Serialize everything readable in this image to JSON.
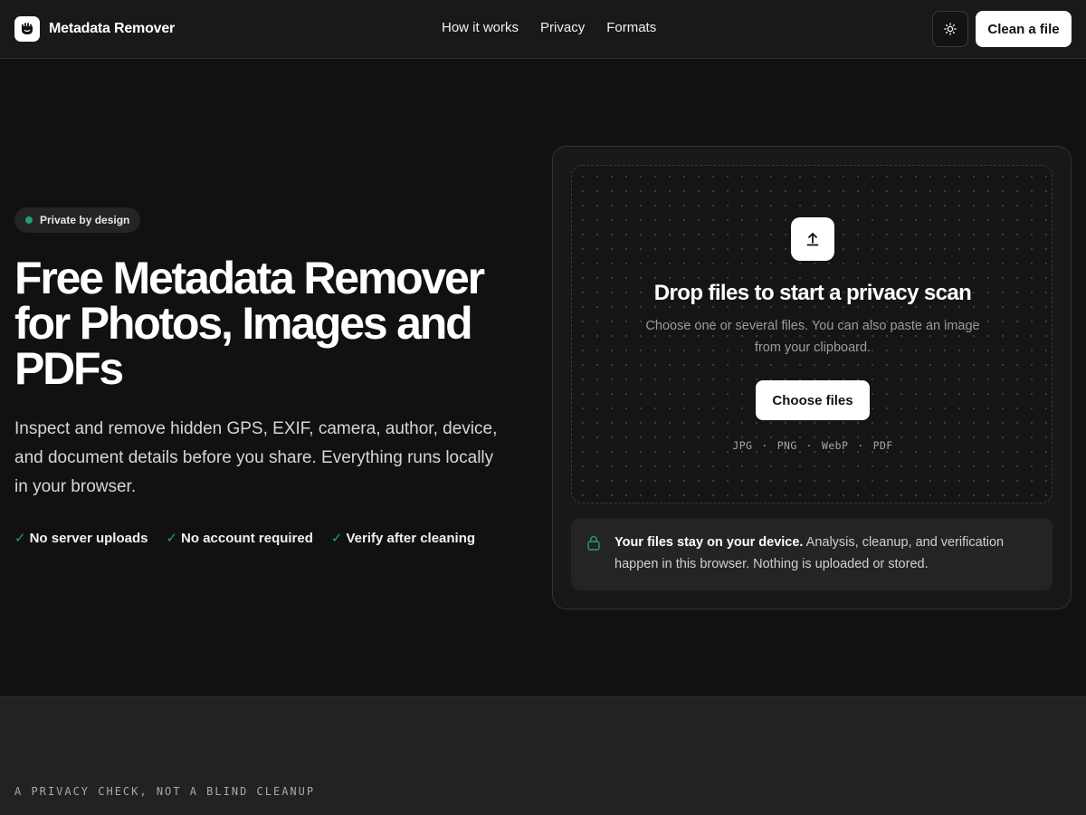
{
  "header": {
    "brand_name": "Metadata Remover",
    "nav": [
      {
        "label": "How it works"
      },
      {
        "label": "Privacy"
      },
      {
        "label": "Formats"
      }
    ],
    "cta_label": "Clean a file",
    "icons": {
      "logo": "hand-shield-icon",
      "theme_toggle": "sun-icon"
    }
  },
  "hero": {
    "badge": "Private by design",
    "title": "Free Metadata Remover for Photos, Images and PDFs",
    "description": "Inspect and remove hidden GPS, EXIF, camera, author, device, and document details before you share. Everything runs locally in your browser.",
    "features": [
      {
        "label": "No server uploads"
      },
      {
        "label": "No account required"
      },
      {
        "label": "Verify after cleaning"
      }
    ]
  },
  "upload": {
    "title": "Drop files to start a privacy scan",
    "subtitle": "Choose one or several files. You can also paste an image from your clipboard.",
    "button_label": "Choose files",
    "formats": [
      "JPG",
      "PNG",
      "WebP",
      "PDF"
    ],
    "format_separator": "·",
    "note_strong": "Your files stay on your device.",
    "note_text": " Analysis, cleanup, and verification happen in this browser. Nothing is uploaded or stored."
  },
  "section2": {
    "eyebrow": "A PRIVACY CHECK, NOT A BLIND CLEANUP"
  },
  "colors": {
    "accent_green": "#22a06b",
    "background": "#111111",
    "surface": "#181818"
  }
}
